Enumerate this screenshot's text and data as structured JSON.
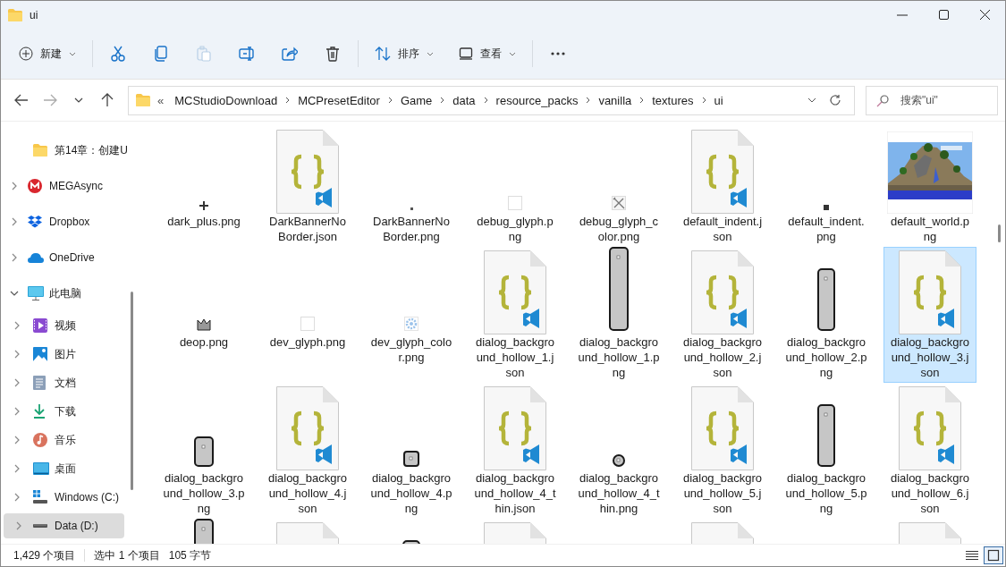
{
  "window": {
    "title": "ui"
  },
  "toolbar": [
    {
      "kind": "new",
      "label": "新建",
      "dropdown": true,
      "disabled": false
    },
    {
      "kind": "separator"
    },
    {
      "kind": "cut",
      "disabled": false
    },
    {
      "kind": "copy",
      "disabled": false
    },
    {
      "kind": "paste",
      "disabled": true
    },
    {
      "kind": "rename",
      "disabled": false
    },
    {
      "kind": "share",
      "disabled": false
    },
    {
      "kind": "delete",
      "disabled": false
    },
    {
      "kind": "separator"
    },
    {
      "kind": "sort",
      "label": "排序",
      "dropdown": true,
      "disabled": false
    },
    {
      "kind": "view",
      "label": "查看",
      "dropdown": true,
      "disabled": false
    },
    {
      "kind": "separator"
    },
    {
      "kind": "more",
      "disabled": false
    }
  ],
  "nav": [
    {
      "kind": "back",
      "disabled": false
    },
    {
      "kind": "forward",
      "disabled": true
    },
    {
      "kind": "recent",
      "disabled": false
    },
    {
      "kind": "up",
      "disabled": false
    }
  ],
  "address": {
    "overflow": "«",
    "segments": [
      "MCStudioDownload",
      "MCPresetEditor",
      "Game",
      "data",
      "resource_packs",
      "vanilla",
      "textures",
      "ui"
    ]
  },
  "search": {
    "placeholder": "搜索\"ui\""
  },
  "sidebar": {
    "items": [
      {
        "label": "第14章：创建U",
        "kind": "folder",
        "selected": false
      },
      {
        "label": "MEGAsync",
        "kind": "mega",
        "expanded": false,
        "selected": false
      },
      {
        "label": "Dropbox",
        "kind": "dropbox",
        "expanded": false,
        "selected": false
      },
      {
        "label": "OneDrive",
        "kind": "onedrive",
        "expanded": false,
        "selected": false
      },
      {
        "label": "此电脑",
        "kind": "pc",
        "expanded": true,
        "selected": false,
        "children": [
          {
            "label": "视频",
            "kind": "videos",
            "expanded": false,
            "selected": false
          },
          {
            "label": "图片",
            "kind": "pictures",
            "expanded": false,
            "selected": false
          },
          {
            "label": "文档",
            "kind": "documents",
            "expanded": false,
            "selected": false
          },
          {
            "label": "下载",
            "kind": "downloads",
            "expanded": false,
            "selected": false
          },
          {
            "label": "音乐",
            "kind": "music",
            "expanded": false,
            "selected": false
          },
          {
            "label": "桌面",
            "kind": "desktop",
            "expanded": false,
            "selected": false
          },
          {
            "label": "Windows (C:)",
            "kind": "windrive",
            "expanded": false,
            "selected": false
          },
          {
            "label": "Data (D:)",
            "kind": "drive",
            "expanded": false,
            "selected": true
          }
        ]
      }
    ]
  },
  "files": [
    {
      "name": "dark_plus.png",
      "kind": "plus",
      "selected": false
    },
    {
      "name": "DarkBannerNoBorder.json",
      "kind": "json",
      "selected": false
    },
    {
      "name": "DarkBannerNoBorder.png",
      "kind": "speck",
      "selected": false
    },
    {
      "name": "debug_glyph.png",
      "kind": "blank",
      "selected": false
    },
    {
      "name": "debug_glyph_color.png",
      "kind": "tools",
      "selected": false
    },
    {
      "name": "default_indent.json",
      "kind": "json",
      "selected": false
    },
    {
      "name": "default_indent.png",
      "kind": "dark-square",
      "selected": false
    },
    {
      "name": "default_world.png",
      "kind": "picture",
      "selected": false
    },
    {
      "name": "deop.png",
      "kind": "crown",
      "selected": false
    },
    {
      "name": "dev_glyph.png",
      "kind": "blank",
      "selected": false
    },
    {
      "name": "dev_glyph_color.png",
      "kind": "gear",
      "selected": false
    },
    {
      "name": "dialog_background_hollow_1.json",
      "kind": "json",
      "selected": false
    },
    {
      "name": "dialog_background_hollow_1.png",
      "kind": "tall-bar",
      "selected": false
    },
    {
      "name": "dialog_background_hollow_2.json",
      "kind": "json",
      "selected": false
    },
    {
      "name": "dialog_background_hollow_2.png",
      "kind": "mid-bar",
      "selected": false
    },
    {
      "name": "dialog_background_hollow_3.json",
      "kind": "json",
      "selected": true
    },
    {
      "name": "dialog_background_hollow_3.png",
      "kind": "short-bar",
      "selected": false
    },
    {
      "name": "dialog_background_hollow_4.json",
      "kind": "json",
      "selected": false
    },
    {
      "name": "dialog_background_hollow_4.png",
      "kind": "square",
      "selected": false
    },
    {
      "name": "dialog_background_hollow_4_thin.json",
      "kind": "json",
      "selected": false
    },
    {
      "name": "dialog_background_hollow_4_thin.png",
      "kind": "round",
      "selected": false
    },
    {
      "name": "dialog_background_hollow_5.json",
      "kind": "json",
      "selected": false
    },
    {
      "name": "dialog_background_hollow_5.png",
      "kind": "mid-bar",
      "selected": false
    },
    {
      "name": "dialog_background_hollow_6.json",
      "kind": "json",
      "selected": false
    },
    {
      "kind": "tall-bar",
      "selected": false
    },
    {
      "kind": "json",
      "selected": false
    },
    {
      "kind": "mid-bar",
      "selected": false
    },
    {
      "kind": "json",
      "selected": false
    },
    {
      "kind": "unseen"
    },
    {
      "kind": "json",
      "selected": false
    },
    {
      "kind": "unseen"
    },
    {
      "kind": "json",
      "selected": false
    }
  ],
  "status_bar": {
    "items": [
      "1,429 个项目",
      "选中 1 个项目",
      "105 字节"
    ],
    "views": [
      {
        "kind": "details",
        "selected": false
      },
      {
        "kind": "tiles",
        "selected": true
      }
    ]
  }
}
